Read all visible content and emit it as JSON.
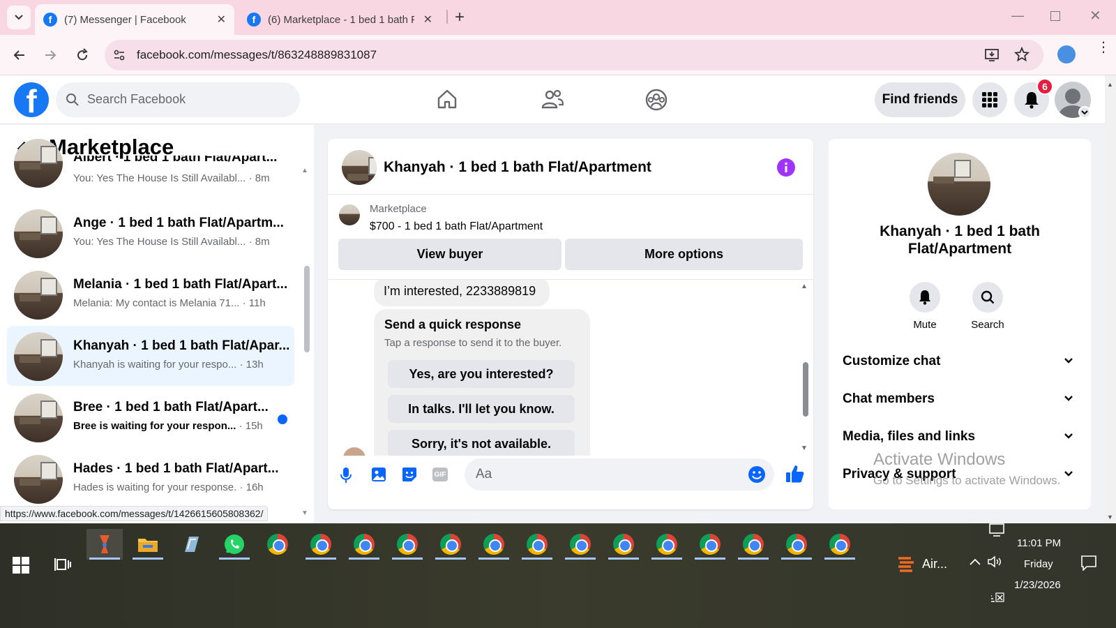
{
  "browser": {
    "tabs": [
      {
        "title": "(7) Messenger | Facebook",
        "active": true
      },
      {
        "title": "(6) Marketplace - 1 bed 1 bath F",
        "active": false
      }
    ],
    "url": "facebook.com/messages/t/863248889831087",
    "status_url": "https://www.facebook.com/messages/t/1426615605808362/"
  },
  "fb_header": {
    "search_placeholder": "Search Facebook",
    "find_friends": "Find friends",
    "notification_count": "6"
  },
  "left_panel": {
    "title": "Marketplace",
    "conversations": [
      {
        "title": "Albert · 1 bed 1 bath Flat/Apart...",
        "preview": "You: Yes The House Is Still Availabl...",
        "time": "· 8m",
        "selected": false,
        "unread": false
      },
      {
        "title": "Ange · 1 bed 1 bath Flat/Apartm...",
        "preview": "You: Yes The House Is Still Availabl...",
        "time": "· 8m",
        "selected": false,
        "unread": false
      },
      {
        "title": "Melania · 1 bed 1 bath Flat/Apart...",
        "preview": "Melania: My contact is Melania 71...",
        "time": "· 11h",
        "selected": false,
        "unread": false
      },
      {
        "title": "Khanyah · 1 bed 1 bath Flat/Apar...",
        "preview": "Khanyah is waiting for your respo...",
        "time": "· 13h",
        "selected": true,
        "unread": false
      },
      {
        "title": "Bree · 1 bed 1 bath Flat/Apart...",
        "preview": "Bree is waiting for your respon...",
        "time": "· 15h",
        "selected": false,
        "unread": true
      },
      {
        "title": "Hades · 1 bed 1 bath Flat/Apart...",
        "preview": "Hades is waiting for your response.",
        "time": "· 16h",
        "selected": false,
        "unread": false
      }
    ]
  },
  "chat": {
    "header_title": "Khanyah · 1 bed 1 bath Flat/Apartment",
    "listing_label": "Marketplace",
    "listing_text": "$700 - 1 bed 1 bath Flat/Apartment",
    "view_buyer": "View buyer",
    "more_options": "More options",
    "message_interested": "I’m interested, 2233889819",
    "quick_title": "Send a quick response",
    "quick_sub": "Tap a response to send it to the buyer.",
    "quick_responses": [
      "Yes, are you interested?",
      "In talks. I'll let you know.",
      "Sorry, it's not available."
    ],
    "composer_placeholder": "Aa"
  },
  "right_panel": {
    "name": "Khanyah · 1 bed 1 bath Flat/Apartment",
    "mute": "Mute",
    "search": "Search",
    "sections": [
      "Customize chat",
      "Chat members",
      "Media, files and links",
      "Privacy & support"
    ],
    "watermark_title": "Activate Windows",
    "watermark_sub": "Go to Settings to activate Windows."
  },
  "taskbar": {
    "time": "11:01 PM",
    "day": "Friday",
    "date": "1/23/2026",
    "air_label": "Air..."
  },
  "colors": {
    "fb_blue": "#1877f2",
    "messenger_purple": "#a033ff",
    "unread_dot": "#0866ff",
    "badge_red": "#e41e3f"
  }
}
